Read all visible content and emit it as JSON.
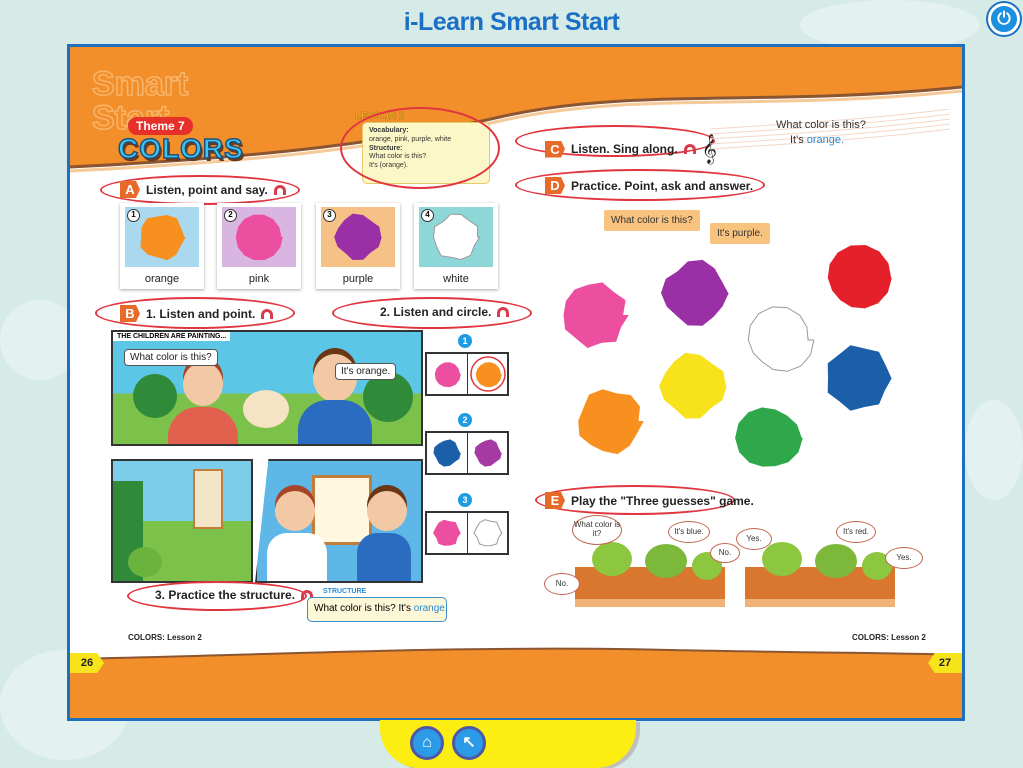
{
  "app": {
    "title": "i-Learn Smart Start",
    "power_icon": "power-icon"
  },
  "header": {
    "watermark": "Smart Start",
    "theme": "Theme 7",
    "title": "COLORS",
    "lesson": {
      "tag": "LESSON 2",
      "vocab_label": "Vocabulary:",
      "vocab": "orange, pink, purple, white",
      "structure_label": "Structure:",
      "structure_lines": [
        "What color is this?",
        "It's (orange)."
      ]
    }
  },
  "section_a": {
    "letter": "A",
    "title": "Listen, point and say.",
    "cards": [
      {
        "num": "1",
        "label": "orange",
        "color": "#f7901e",
        "bg": "#a9d8ef"
      },
      {
        "num": "2",
        "label": "pink",
        "color": "#ec4fa0",
        "bg": "#d9b6e2"
      },
      {
        "num": "3",
        "label": "purple",
        "color": "#9b2fa5",
        "bg": "#f6c187"
      },
      {
        "num": "4",
        "label": "white",
        "color": "#ffffff",
        "bg": "#8ed7d9"
      }
    ]
  },
  "section_b": {
    "letter": "B",
    "title1": "1. Listen and point.",
    "title2": "2. Listen and circle.",
    "title3": "3. Practice the structure.",
    "caption": "THE CHILDREN ARE PAINTING...",
    "bubble_q": "What color is this?",
    "bubble_a": "It's orange.",
    "circle_items": [
      {
        "num": "1",
        "left": "#ec4fa0",
        "right": "#f7901e",
        "circled": "right"
      },
      {
        "num": "2",
        "left": "#1a5fa8",
        "right": "#a63aa3",
        "circled": ""
      },
      {
        "num": "3",
        "left": "#ec4fa0",
        "right": "#ffffff",
        "circled": ""
      }
    ],
    "structure": {
      "label": "STRUCTURE",
      "text": "What color is this? It's ",
      "highlight": "orange."
    }
  },
  "section_c": {
    "letter": "C",
    "title": "Listen. Sing along.",
    "song_line1": "What color is this?",
    "song_line2a": "It's ",
    "song_line2b": "orange."
  },
  "section_d": {
    "letter": "D",
    "title": "Practice.  Point, ask and answer.",
    "question": "What color is this?",
    "answer": "It's purple.",
    "blobs": [
      "#ec4fa0",
      "#9b2fa5",
      "#e4202a",
      "#ffffff",
      "#f7e21b",
      "#1a5fa8",
      "#f7901e",
      "#2ea84a"
    ]
  },
  "section_e": {
    "letter": "E",
    "title": "Play the \"Three guesses\" game.",
    "bubbles_left": [
      "What color is it?",
      "It's blue.",
      "No.",
      "No."
    ],
    "bubbles_right": [
      "Yes.",
      "It's red.",
      "Yes."
    ]
  },
  "footer": {
    "left_label": "COLORS: Lesson 2",
    "right_label": "COLORS: Lesson 2",
    "page_left": "26",
    "page_right": "27"
  },
  "nav": {
    "home_icon": "home-icon",
    "back_icon": "back-arrow-icon"
  },
  "colors": {
    "accent": "#f7901e",
    "frame": "#1f6fc0",
    "section_ring": "#e1363f"
  }
}
